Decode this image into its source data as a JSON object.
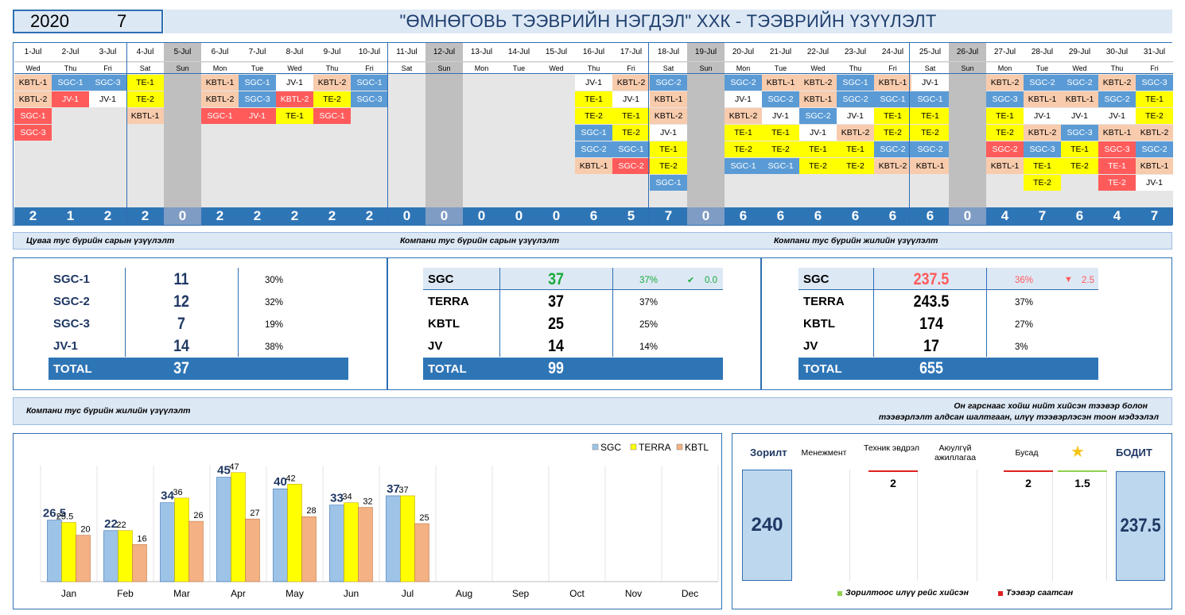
{
  "header": {
    "year": "2020",
    "month": "7",
    "title": "\"ӨМНӨГОВЬ ТЭЭВРИЙН НЭГДЭЛ\" ХХК - ТЭЭВРИЙН ҮЗҮҮЛЭЛТ"
  },
  "colors": {
    "SGC": "#5b9bd5",
    "TERRA": "#ffff00",
    "KBTL": "#f8cbad",
    "JV": "#ffffff",
    "red": "#ff5b5b",
    "blue": "#2e75b6",
    "sunday": "#bfbfbf",
    "empty": "#e6e6e6"
  },
  "calendar": [
    {
      "date": "1-Jul",
      "dow": "Wed",
      "count": "2",
      "items": [
        "KBTL-1",
        "KBTL-2",
        "SGC-1",
        "SGC-3"
      ]
    },
    {
      "date": "2-Jul",
      "dow": "Thu",
      "count": "1",
      "items": [
        "SGC-1",
        "JV-1"
      ]
    },
    {
      "date": "3-Jul",
      "dow": "Fri",
      "count": "2",
      "items": [
        "SGC-3",
        "JV-1"
      ]
    },
    {
      "date": "4-Jul",
      "dow": "Sat",
      "count": "2",
      "items": [
        "TE-1",
        "TE-2",
        "KBTL-1"
      ]
    },
    {
      "date": "5-Jul",
      "dow": "Sun",
      "count": "0",
      "items": []
    },
    {
      "date": "6-Jul",
      "dow": "Mon",
      "count": "2",
      "items": [
        "KBTL-1",
        "KBTL-2",
        "SGC-1"
      ]
    },
    {
      "date": "7-Jul",
      "dow": "Tue",
      "count": "2",
      "items": [
        "SGC-1",
        "SGC-3",
        "JV-1"
      ]
    },
    {
      "date": "8-Jul",
      "dow": "Wed",
      "count": "2",
      "items": [
        "JV-1",
        "KBTL-2",
        "TE-1"
      ]
    },
    {
      "date": "9-Jul",
      "dow": "Thu",
      "count": "2",
      "items": [
        "KBTL-2",
        "TE-2",
        "SGC-1"
      ]
    },
    {
      "date": "10-Jul",
      "dow": "Fri",
      "count": "2",
      "items": [
        "SGC-1",
        "SGC-3"
      ]
    },
    {
      "date": "11-Jul",
      "dow": "Sat",
      "count": "0",
      "items": []
    },
    {
      "date": "12-Jul",
      "dow": "Sun",
      "count": "0",
      "items": []
    },
    {
      "date": "13-Jul",
      "dow": "Mon",
      "count": "0",
      "items": []
    },
    {
      "date": "14-Jul",
      "dow": "Tue",
      "count": "0",
      "items": []
    },
    {
      "date": "15-Jul",
      "dow": "Wed",
      "count": "0",
      "items": []
    },
    {
      "date": "16-Jul",
      "dow": "Thu",
      "count": "6",
      "items": [
        "JV-1",
        "TE-1",
        "TE-2",
        "SGC-1",
        "SGC-2",
        "KBTL-1"
      ]
    },
    {
      "date": "17-Jul",
      "dow": "Fri",
      "count": "5",
      "items": [
        "KBTL-2",
        "JV-1",
        "TE-1",
        "TE-2",
        "SGC-1",
        "SGC-2"
      ]
    },
    {
      "date": "18-Jul",
      "dow": "Sat",
      "count": "7",
      "items": [
        "SGC-2",
        "KBTL-1",
        "KBTL-2",
        "JV-1",
        "TE-1",
        "TE-2",
        "SGC-1"
      ]
    },
    {
      "date": "19-Jul",
      "dow": "Sun",
      "count": "0",
      "items": []
    },
    {
      "date": "20-Jul",
      "dow": "Mon",
      "count": "6",
      "items": [
        "SGC-2",
        "JV-1",
        "KBTL-2",
        "TE-1",
        "TE-2",
        "SGC-1"
      ]
    },
    {
      "date": "21-Jul",
      "dow": "Tue",
      "count": "6",
      "items": [
        "KBTL-1",
        "SGC-2",
        "JV-1",
        "TE-1",
        "TE-2",
        "SGC-1"
      ]
    },
    {
      "date": "22-Jul",
      "dow": "Wed",
      "count": "6",
      "items": [
        "KBTL-2",
        "KBTL-1",
        "SGC-2",
        "JV-1",
        "TE-1",
        "TE-2"
      ]
    },
    {
      "date": "23-Jul",
      "dow": "Thu",
      "count": "6",
      "items": [
        "SGC-1",
        "SGC-2",
        "JV-1",
        "KBTL-2",
        "TE-1",
        "TE-2"
      ]
    },
    {
      "date": "24-Jul",
      "dow": "Fri",
      "count": "6",
      "items": [
        "KBTL-1",
        "SGC-1",
        "TE-1",
        "TE-2",
        "SGC-2",
        "KBTL-2"
      ]
    },
    {
      "date": "25-Jul",
      "dow": "Sat",
      "count": "6",
      "items": [
        "JV-1",
        "SGC-1",
        "TE-1",
        "TE-2",
        "SGC-2",
        "KBTL-1"
      ]
    },
    {
      "date": "26-Jul",
      "dow": "Sun",
      "count": "0",
      "items": []
    },
    {
      "date": "27-Jul",
      "dow": "Mon",
      "count": "4",
      "items": [
        "KBTL-2",
        "SGC-3",
        "TE-1",
        "TE-2",
        "SGC-2",
        "KBTL-1"
      ]
    },
    {
      "date": "28-Jul",
      "dow": "Tue",
      "count": "7",
      "items": [
        "SGC-2",
        "KBTL-1",
        "JV-1",
        "KBTL-2",
        "SGC-3",
        "TE-1",
        "TE-2"
      ]
    },
    {
      "date": "29-Jul",
      "dow": "Wed",
      "count": "6",
      "items": [
        "SGC-2",
        "KBTL-1",
        "JV-1",
        "SGC-3",
        "TE-1",
        "TE-2"
      ]
    },
    {
      "date": "30-Jul",
      "dow": "Thu",
      "count": "4",
      "items": [
        "KBTL-2",
        "SGC-2",
        "JV-1",
        "KBTL-1",
        "SGC-3",
        "TE-1",
        "TE-2"
      ]
    },
    {
      "date": "31-Jul",
      "dow": "Fri",
      "count": "7",
      "items": [
        "SGC-3",
        "TE-1",
        "TE-2",
        "KBTL-2",
        "SGC-2",
        "KBTL-1",
        "JV-1"
      ]
    }
  ],
  "redItems": [
    "1-Jul|SGC-1",
    "1-Jul|SGC-3",
    "2-Jul|JV-1",
    "6-Jul|SGC-1",
    "7-Jul|JV-1",
    "8-Jul|KBTL-2",
    "9-Jul|SGC-1",
    "17-Jul|SGC-2",
    "27-Jul|SGC-2",
    "30-Jul|SGC-3",
    "30-Jul|TE-1",
    "30-Jul|TE-2"
  ],
  "sections": {
    "s1": "Цуваа тус бүрийн сарын үзүүлэлт",
    "s2": "Компани тус бүрийн сарын үзүүлэлт",
    "s3": "Компани тус бүрийн жилийн үзүүлэлт",
    "s4": "Компани тус бүрийн жилийн үзүүлэлт",
    "s4_right_1": "Он гарснаас хойш нийт хийсэн тээвэр болон",
    "s4_right_2": "тээвэрлэлт алдсан шалтгаан, илүү тээвэрлэсэн тоон мэдээлэл"
  },
  "convoy": {
    "rows": [
      {
        "name": "SGC-1",
        "value": "11",
        "pct": "30%"
      },
      {
        "name": "SGC-2",
        "value": "12",
        "pct": "32%"
      },
      {
        "name": "SGC-3",
        "value": "7",
        "pct": "19%"
      },
      {
        "name": "JV-1",
        "value": "14",
        "pct": "38%"
      }
    ],
    "total_label": "TOTAL",
    "total": "37"
  },
  "company_month": {
    "rows": [
      {
        "name": "SGC",
        "value": "37",
        "pct": "37%",
        "delta": "0.0"
      },
      {
        "name": "TERRA",
        "value": "37",
        "pct": "37%"
      },
      {
        "name": "KBTL",
        "value": "25",
        "pct": "25%"
      },
      {
        "name": "JV",
        "value": "14",
        "pct": "14%"
      }
    ],
    "total_label": "TOTAL",
    "total": "99"
  },
  "company_year": {
    "rows": [
      {
        "name": "SGC",
        "value": "237.5",
        "pct": "36%",
        "delta": "2.5"
      },
      {
        "name": "TERRA",
        "value": "243.5",
        "pct": "37%"
      },
      {
        "name": "KBTL",
        "value": "174",
        "pct": "27%"
      },
      {
        "name": "JV",
        "value": "17",
        "pct": "3%"
      }
    ],
    "total_label": "TOTAL",
    "total": "655"
  },
  "chart_data": {
    "type": "bar",
    "categories": [
      "Jan",
      "Feb",
      "Mar",
      "Apr",
      "May",
      "Jun",
      "Jul",
      "Aug",
      "Sep",
      "Oct",
      "Nov",
      "Dec"
    ],
    "series": [
      {
        "name": "SGC",
        "values": [
          26.5,
          22,
          34,
          45,
          40,
          33,
          37,
          null,
          null,
          null,
          null,
          null
        ],
        "color": "#9dc3e6"
      },
      {
        "name": "TERRA",
        "values": [
          25.5,
          22,
          36,
          47,
          42,
          34,
          37,
          null,
          null,
          null,
          null,
          null
        ],
        "color": "#ffff00"
      },
      {
        "name": "KBTL",
        "values": [
          20,
          16,
          26,
          27,
          28,
          32,
          25,
          null,
          null,
          null,
          null,
          null
        ],
        "color": "#f4b183"
      }
    ],
    "ylim": [
      0,
      50
    ]
  },
  "target": {
    "goal_label": "Зорилт",
    "goal": "240",
    "actual_label": "БОДИТ",
    "actual": "237.5",
    "columns": [
      {
        "label": "Менежмент",
        "value": "",
        "kind": ""
      },
      {
        "label": "Техник эвдрэл",
        "value": "2",
        "kind": "red"
      },
      {
        "label": "Аюулгүй ажиллагаа",
        "value": "",
        "kind": ""
      },
      {
        "label": "Бусад",
        "value": "2",
        "kind": "red"
      },
      {
        "label": "",
        "value": "1.5",
        "kind": "green"
      }
    ],
    "legend_green": "Зорилтоос илүү рейс хийсэн",
    "legend_red": "Тээвэр саатсан"
  }
}
